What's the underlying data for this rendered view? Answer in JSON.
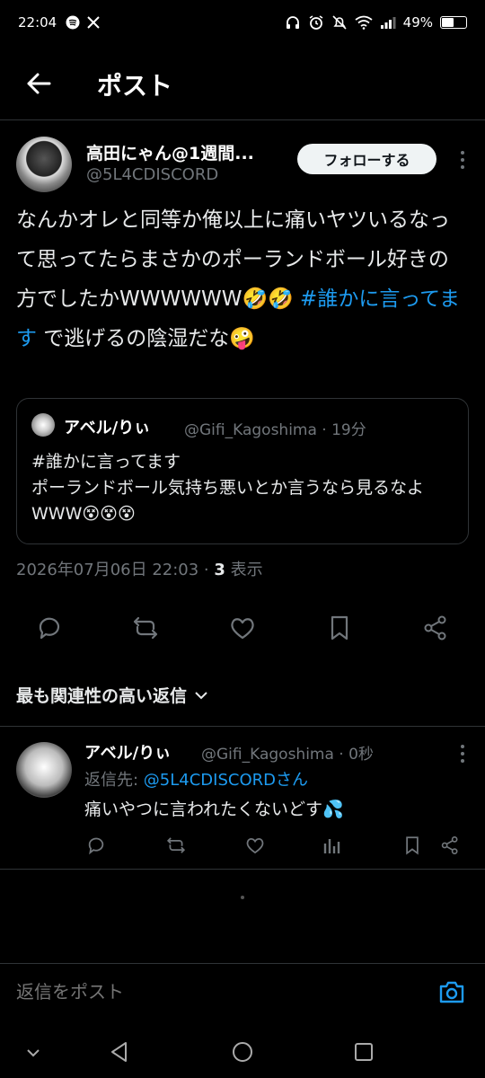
{
  "status_bar": {
    "time": "22:04",
    "battery": "49%"
  },
  "header": {
    "title": "ポスト"
  },
  "author": {
    "name": "高田にゃん@1週間...",
    "handle": "@5L4CDISCORD",
    "follow_label": "フォローする"
  },
  "post": {
    "text_1": "なんかオレと同等か俺以上に痛いヤツいるなって思ってたらまさかのポーランドボール好きの方でしたかWWWWWW🤣🤣 ",
    "hashtag": "#誰かに言ってます",
    "text_2": " で逃げるの陰湿だな🤪"
  },
  "quote": {
    "name": "アベル/りぃ",
    "meta": "@Gifi_Kagoshima · 19分",
    "line_1": "#誰かに言ってます",
    "line_2": "ポーランドボール気持ち悪いとか言うなら見るなよWWW😵😵😵"
  },
  "timestamp": {
    "date": "2026年07月06日 22:03 · ",
    "views_count": "3",
    "views_label": " 表示"
  },
  "sort": {
    "label": "最も関連性の高い返信"
  },
  "reply": {
    "name": "アベル/りぃ",
    "meta": "@Gifi_Kagoshima · 0秒",
    "reply_to_label": "返信先: ",
    "reply_to_mention": "@5L4CDISCORDさん",
    "text": "痛いやつに言われたくないどす💦"
  },
  "compose": {
    "placeholder": "返信をポスト"
  },
  "colors": {
    "accent": "#1d9bf0",
    "background": "#000000",
    "muted": "#71767b"
  }
}
